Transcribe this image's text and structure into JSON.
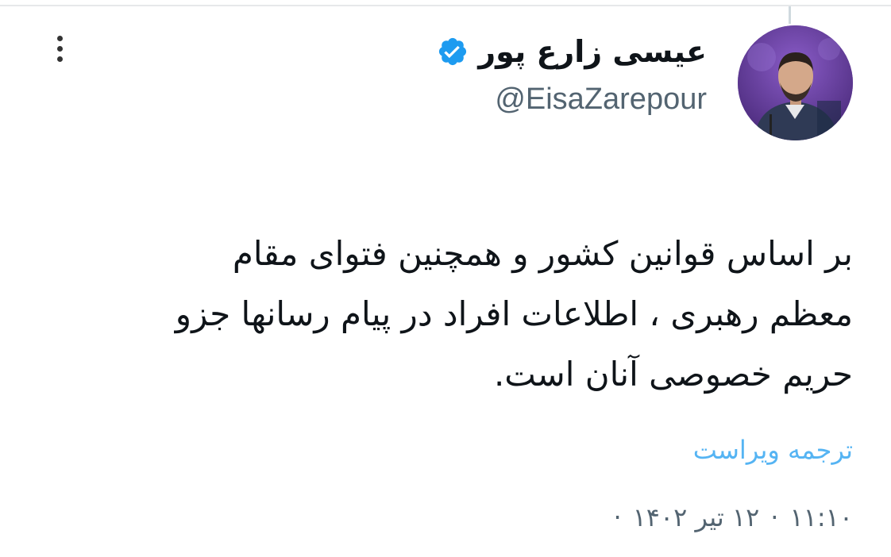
{
  "author": {
    "display_name": "عیسی زارع پور",
    "handle": "@EisaZarepour",
    "verified": true,
    "avatar_icon": "profile-photo"
  },
  "menu": {
    "icon": "more-vertical-icon"
  },
  "tweet": {
    "lines": [
      "بر اساس قوانین کشور و همچنین فتوای مقام",
      "معظم رهبری ، اطلاعات افراد در پیام رسانها  جزو",
      "حریم خصوصی آنان است."
    ]
  },
  "translate_label": "ترجمه ویراست",
  "meta": {
    "time": "۱۱:۱۰",
    "date": "۱۲ تیر ۱۴۰۲",
    "separator": "·"
  },
  "colors": {
    "verified": "#1d9bf0",
    "link": "#1d9bf0",
    "muted": "#536471",
    "text": "#0f1419"
  }
}
